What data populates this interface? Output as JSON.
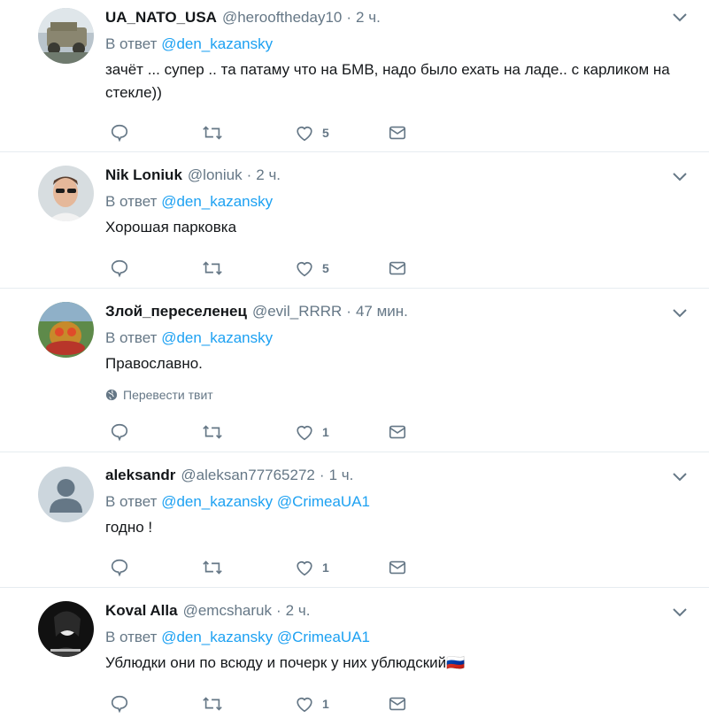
{
  "tweets": [
    {
      "name": "UA_NATO_USA",
      "handle": "@herooftheday10",
      "dot": "·",
      "time": "2 ч.",
      "reply_prefix": "В ответ",
      "mentions": [
        "@den_kazansky"
      ],
      "text": "зачёт ... супер .. та патаму что на БМВ, надо было ехать на ладе.. с карликом на стекле))",
      "likes": "5"
    },
    {
      "name": "Nik Loniuk",
      "handle": "@loniuk",
      "dot": "·",
      "time": "2 ч.",
      "reply_prefix": "В ответ",
      "mentions": [
        "@den_kazansky"
      ],
      "text": "Хорошая парковка",
      "likes": "5"
    },
    {
      "name": "Злой_переселенец",
      "handle": "@evil_RRRR",
      "dot": "·",
      "time": "47 мин.",
      "reply_prefix": "В ответ",
      "mentions": [
        "@den_kazansky"
      ],
      "text": "Православно.",
      "translate": "Перевести твит",
      "likes": "1"
    },
    {
      "name": "aleksandr",
      "handle": "@aleksan77765272",
      "dot": "·",
      "time": "1 ч.",
      "reply_prefix": "В ответ",
      "mentions": [
        "@den_kazansky",
        "@CrimeaUA1"
      ],
      "text": "годно  !",
      "likes": "1"
    },
    {
      "name": "Koval Alla",
      "handle": "@emcsharuk",
      "dot": "·",
      "time": "2 ч.",
      "reply_prefix": "В ответ",
      "mentions": [
        "@den_kazansky",
        "@CrimeaUA1"
      ],
      "text": "Ублюдки они по всюду и почерк у них ублюдский🇷🇺",
      "likes": "1"
    }
  ],
  "icons": [
    "reply-icon",
    "retweet-icon",
    "like-icon",
    "message-icon",
    "chevron-down-icon",
    "globe-icon"
  ],
  "colors": {
    "link": "#1da1f2",
    "secondary": "#657786",
    "border": "#e6ecf0"
  }
}
